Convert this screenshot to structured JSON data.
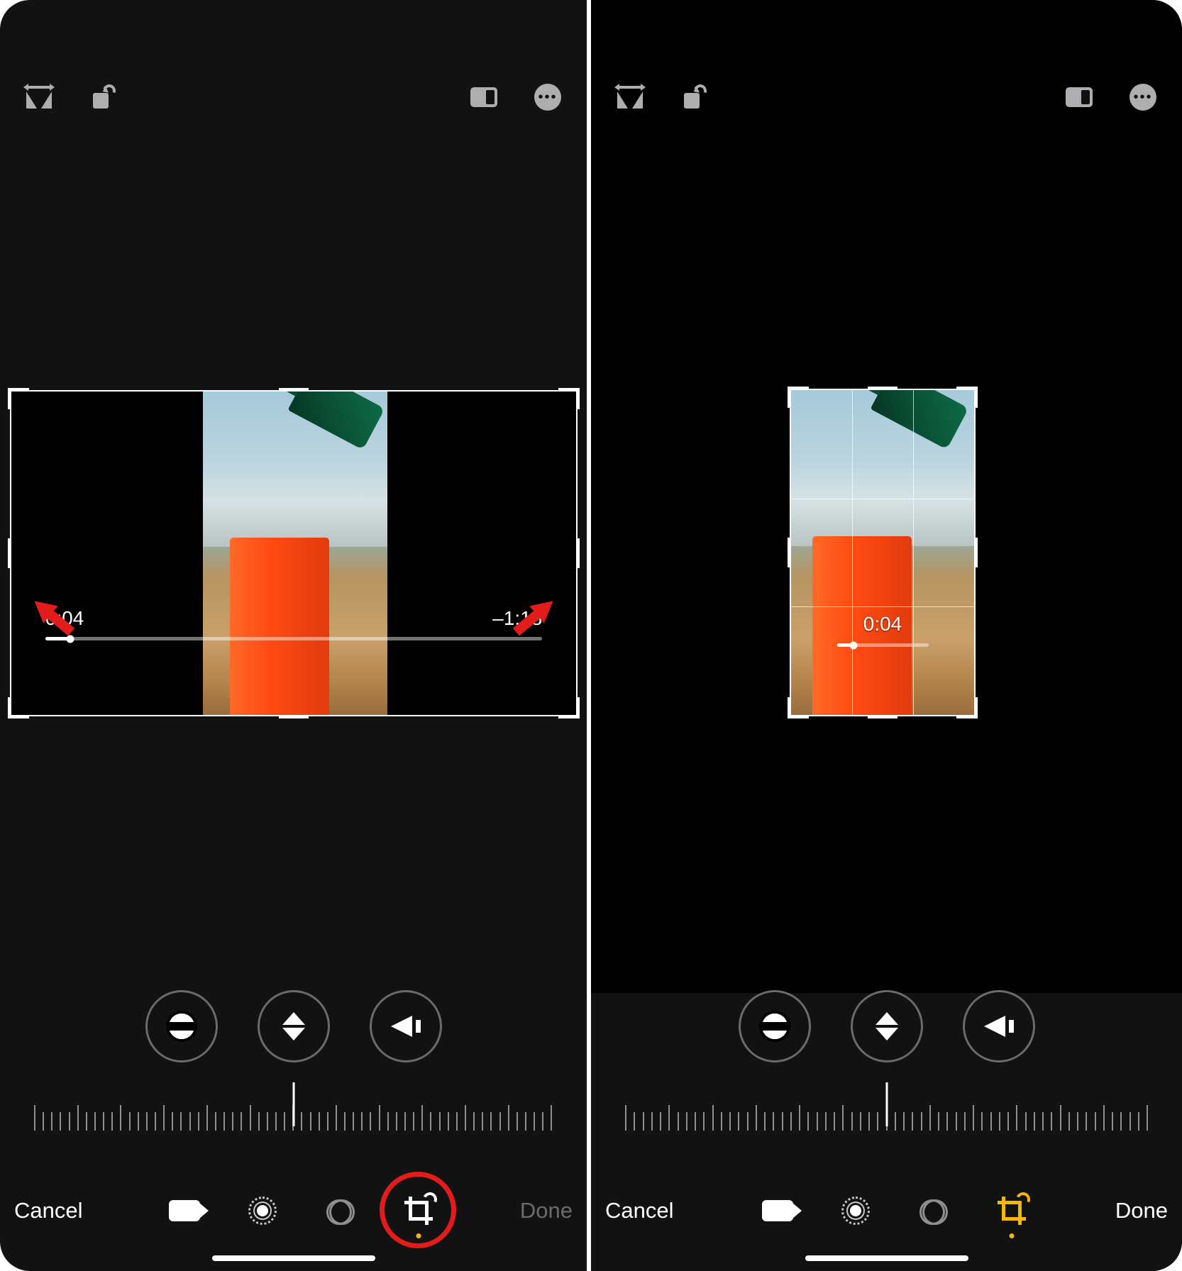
{
  "panels": {
    "left": {
      "topbar": {
        "flip": "flip-horizontal",
        "rotate": "rotate-ccw",
        "aspect": "aspect-ratio",
        "more": "more-options"
      },
      "video": {
        "current_time": "0:04",
        "remaining_time": "–1:18",
        "progress_pct": 5
      },
      "annotation": {
        "left_arrow": true,
        "right_arrow": true,
        "crop_circle": true
      },
      "adjust_buttons": [
        "straighten",
        "vertical-perspective",
        "horizontal-perspective"
      ],
      "bottombar": {
        "cancel_label": "Cancel",
        "done_label": "Done",
        "done_enabled": false,
        "tabs": [
          "video",
          "adjust",
          "filters",
          "crop"
        ],
        "active_tab": "crop"
      }
    },
    "right": {
      "topbar": {
        "flip": "flip-horizontal",
        "rotate": "rotate-ccw",
        "aspect": "aspect-ratio",
        "more": "more-options"
      },
      "video": {
        "current_time": "0:04",
        "progress_pct": 18
      },
      "grid": true,
      "adjust_buttons": [
        "straighten",
        "vertical-perspective",
        "horizontal-perspective"
      ],
      "bottombar": {
        "cancel_label": "Cancel",
        "done_label": "Done",
        "done_enabled": true,
        "tabs": [
          "video",
          "adjust",
          "filters",
          "crop"
        ],
        "active_tab": "crop"
      }
    }
  },
  "colors": {
    "accent_red": "#e21b1b",
    "active_dot": "#f6b700"
  }
}
